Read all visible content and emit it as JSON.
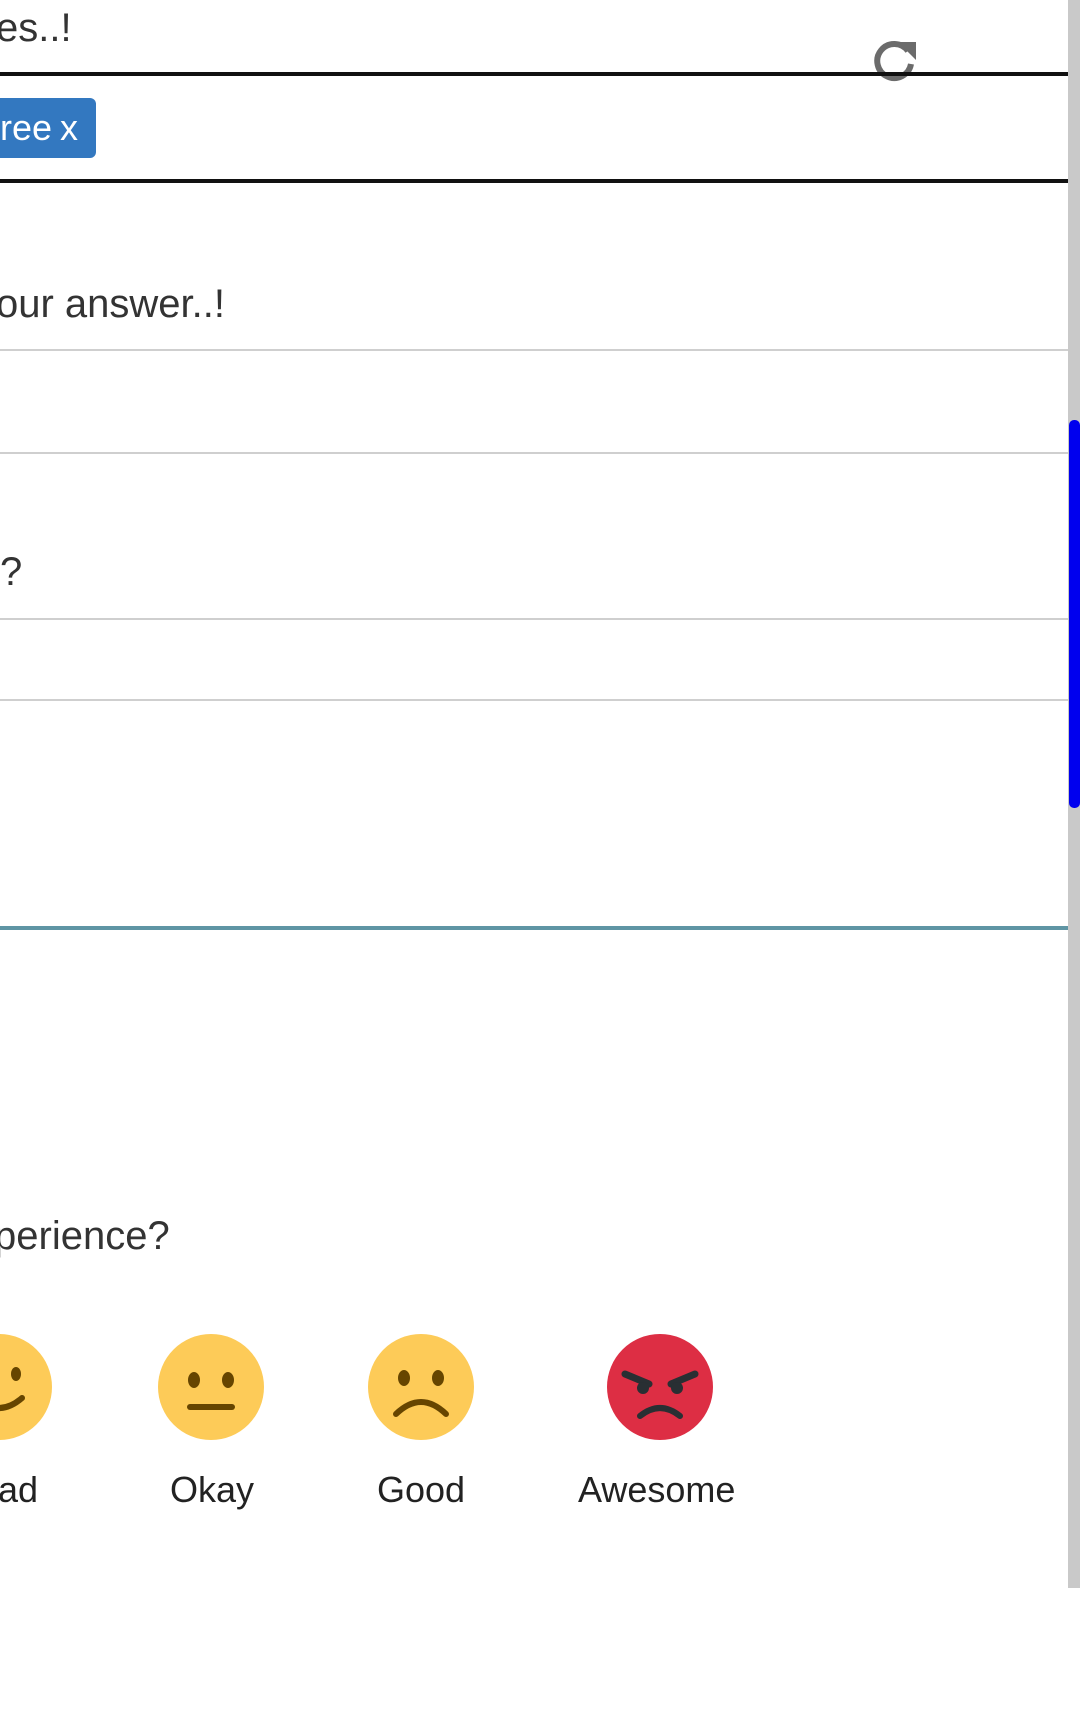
{
  "form": {
    "top_question_fragment": "es..!",
    "tag_chip": {
      "label": "ree",
      "remove": "x"
    },
    "answer_prompt_fragment": "our answer..!",
    "question2_fragment": "?"
  },
  "rating": {
    "question_fragment": "perience?",
    "options": [
      {
        "label": "ad",
        "icon": "smiling-face-icon",
        "color": "#FDCB58"
      },
      {
        "label": "Okay",
        "icon": "neutral-face-icon",
        "color": "#FDCB58"
      },
      {
        "label": "Good",
        "icon": "frowning-face-icon",
        "color": "#FDCB58"
      },
      {
        "label": "Awesome",
        "icon": "angry-face-icon",
        "color": "#DD2E44"
      }
    ]
  },
  "colors": {
    "chip_blue": "#3378C0",
    "scroll_thumb": "#0000EE",
    "divider_teal": "#5F95A4"
  }
}
